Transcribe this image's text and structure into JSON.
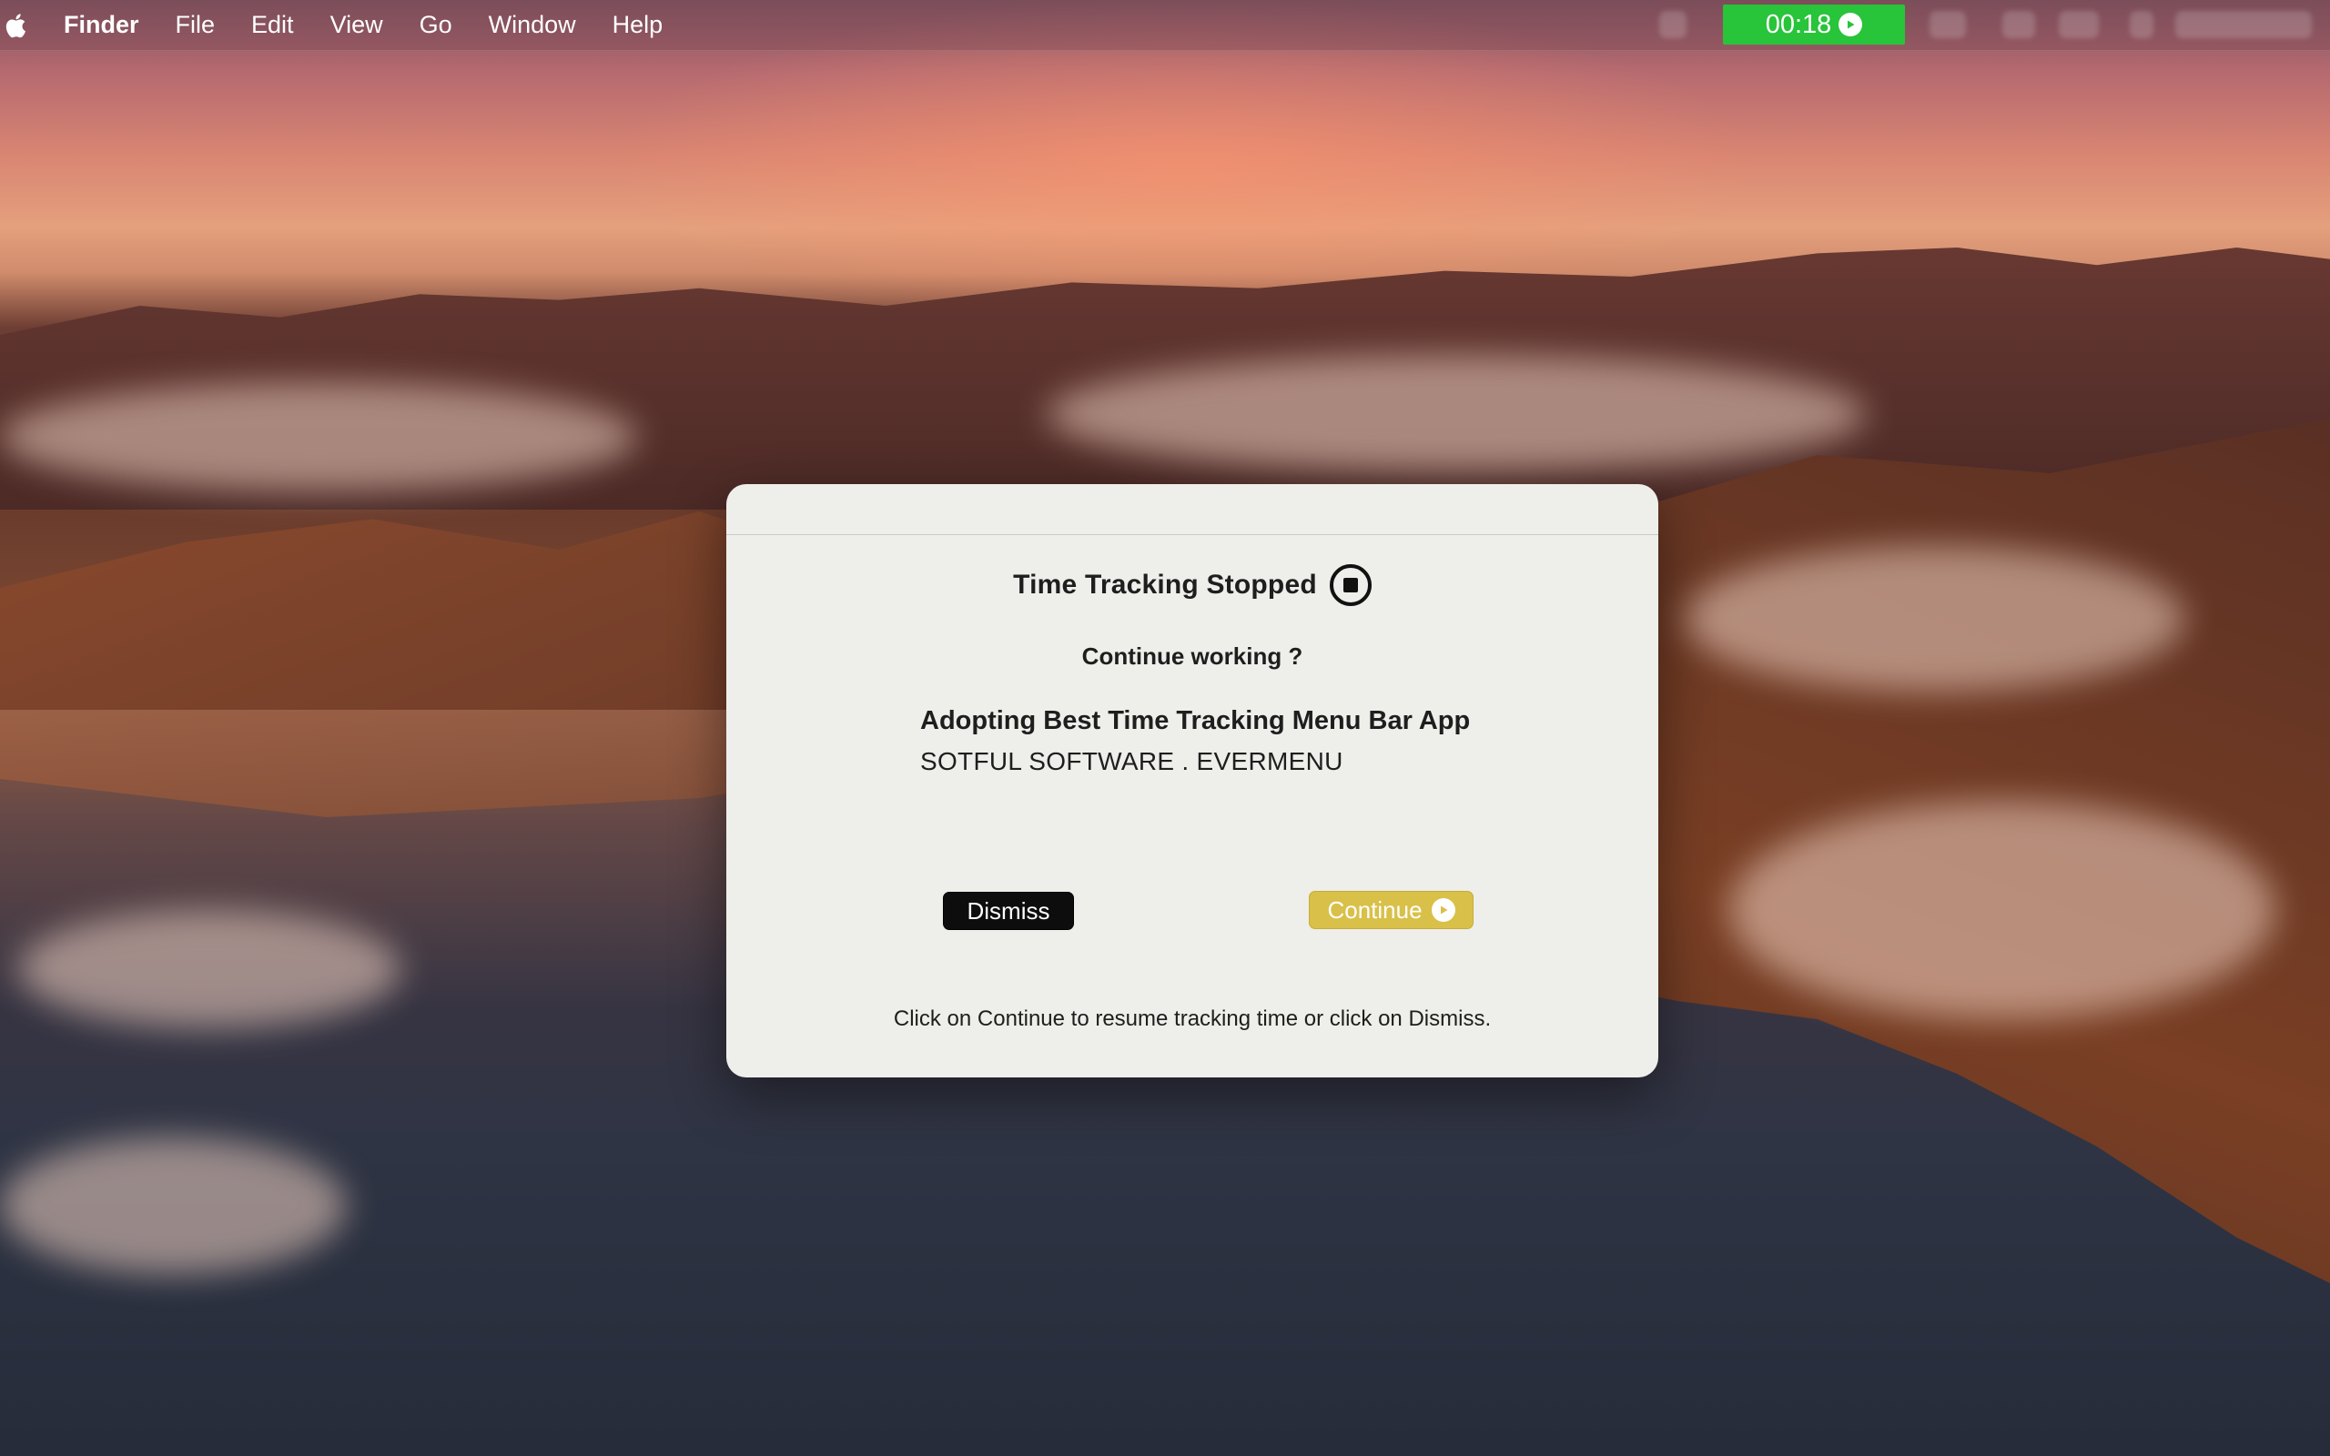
{
  "menubar": {
    "app_name": "Finder",
    "items": [
      "File",
      "Edit",
      "View",
      "Go",
      "Window",
      "Help"
    ],
    "timer": "00:18"
  },
  "dialog": {
    "title": "Time Tracking Stopped",
    "question": "Continue working ?",
    "task_title": "Adopting Best Time Tracking Menu Bar App",
    "task_subtitle": "SOTFUL SOFTWARE . EVERMENU",
    "dismiss_label": "Dismiss",
    "continue_label": "Continue",
    "hint": "Click on Continue to resume tracking time or click on Dismiss."
  },
  "colors": {
    "timer_bg": "#28c43a",
    "continue_bg": "#d9c048",
    "dismiss_bg": "#0d0d0d",
    "dialog_bg": "#eeeeea"
  }
}
